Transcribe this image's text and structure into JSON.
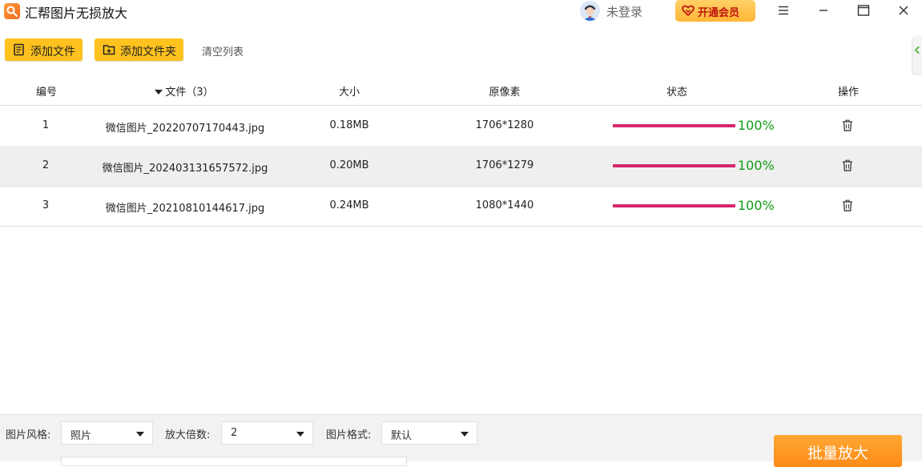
{
  "app": {
    "title": "汇帮图片无损放大"
  },
  "titlebar": {
    "login_label": "未登录",
    "vip_label": "开通会员"
  },
  "toolbar": {
    "add_file_label": "添加文件",
    "add_folder_label": "添加文件夹",
    "clear_label": "清空列表",
    "accent_color": "#ffc21f"
  },
  "table": {
    "columns": {
      "index": "编号",
      "file": "文件（3）",
      "size": "大小",
      "pixels": "原像素",
      "status": "状态",
      "action": "操作"
    },
    "rows": [
      {
        "index": "1",
        "file": "微信图片_20220707170443.jpg",
        "size": "0.18MB",
        "pixels": "1706*1280",
        "progress": 1.0,
        "progress_text": "100%",
        "action_icon": "trash-icon"
      },
      {
        "index": "2",
        "file": "微信图片_202403131657572.jpg",
        "size": "0.20MB",
        "pixels": "1706*1279",
        "progress": 1.0,
        "progress_text": "100%",
        "action_icon": "trash-icon"
      },
      {
        "index": "3",
        "file": "微信图片_20210810144617.jpg",
        "size": "0.24MB",
        "pixels": "1080*1440",
        "progress": 1.0,
        "progress_text": "100%",
        "action_icon": "trash-icon"
      }
    ],
    "progress_color": "#d6266b",
    "progress_text_color": "#129a14"
  },
  "options": {
    "style_label": "图片风格:",
    "style_value": "照片",
    "scale_label": "放大倍数:",
    "scale_value": "2",
    "format_label": "图片格式:",
    "format_value": "默认"
  },
  "actions": {
    "batch_label": "批量放大",
    "batch_color": "#ff9a22"
  }
}
